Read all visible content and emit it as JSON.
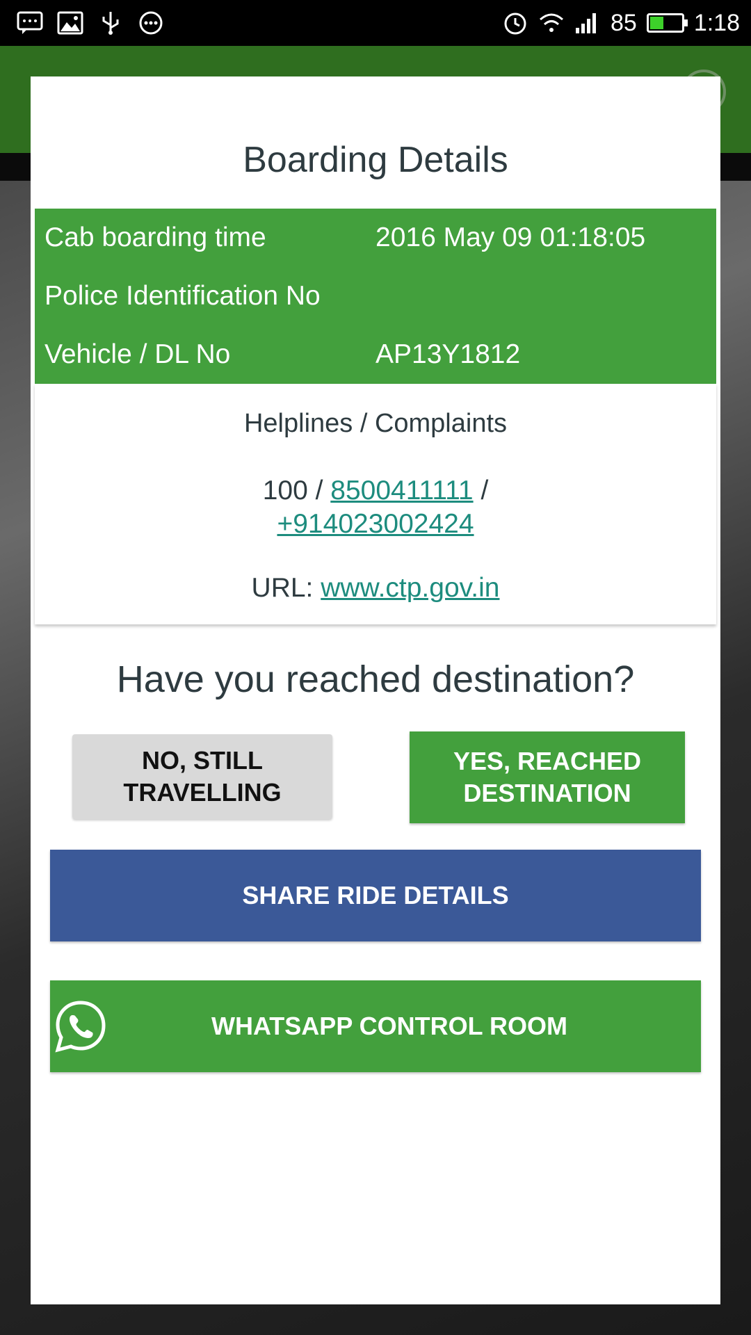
{
  "status_bar": {
    "left_icons": [
      "message-icon",
      "image-icon",
      "usb-icon",
      "more-icon"
    ],
    "right_icons": [
      "alarm-icon",
      "wifi-icon",
      "signal-icon",
      "battery-icon"
    ],
    "battery_level": "85",
    "time": "1:18"
  },
  "dialog": {
    "title": "Boarding Details",
    "details": [
      {
        "label": "Cab boarding time",
        "value": "2016 May 09 01:18:05"
      },
      {
        "label": "Police Identification No",
        "value": ""
      },
      {
        "label": "Vehicle / DL No",
        "value": "AP13Y1812"
      }
    ],
    "helplines": {
      "title": "Helplines / Complaints",
      "prefix": "100 /",
      "phone1": "8500411111",
      "separator": "/",
      "phone2": "+914023002424",
      "url_label": "URL:",
      "url": "www.ctp.gov.in"
    },
    "question": "Have you reached destination?",
    "no_button": "NO, STILL TRAVELLING",
    "yes_button": "YES, REACHED DESTINATION",
    "share_button": "SHARE RIDE DETAILS",
    "whatsapp_button": "WHATSAPP CONTROL ROOM"
  },
  "colors": {
    "green": "#43a03d",
    "facebook_blue": "#3b5998",
    "link_teal": "#1d8c7e",
    "grey_button": "#d9d9d9"
  }
}
